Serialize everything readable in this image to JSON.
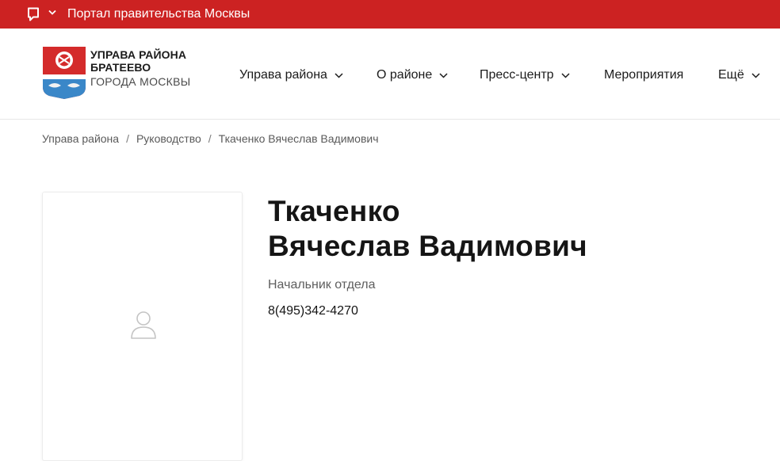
{
  "topbar": {
    "portal_link": "Портал правительства Москвы",
    "accent": "#cc2222"
  },
  "header": {
    "org_line1": "УПРАВА РАЙОНА",
    "org_line2": "БРАТЕЕВО",
    "org_line3": "ГОРОДА МОСКВЫ",
    "nav": [
      {
        "label": "Управа района",
        "dropdown": true
      },
      {
        "label": "О районе",
        "dropdown": true
      },
      {
        "label": "Пресс-центр",
        "dropdown": true
      },
      {
        "label": "Мероприятия",
        "dropdown": false
      },
      {
        "label": "Ещё",
        "dropdown": true
      }
    ]
  },
  "breadcrumb": {
    "items": [
      "Управа района",
      "Руководство",
      "Ткаченко Вячеслав Вадимович"
    ],
    "separator": "/"
  },
  "person": {
    "surname": "Ткаченко",
    "given_names": "Вячеслав Вадимович",
    "position": "Начальник отдела",
    "phone": "8(495)342-4270"
  }
}
